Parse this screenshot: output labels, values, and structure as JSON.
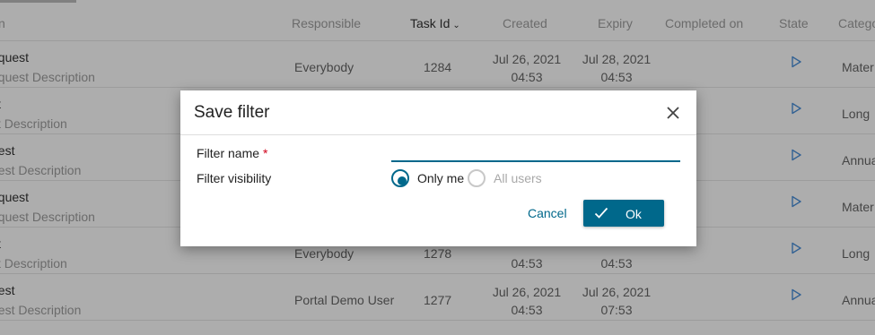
{
  "table": {
    "columns": {
      "name": "n",
      "responsible": "Responsible",
      "task_id": "Task Id",
      "created": "Created",
      "expiry": "Expiry",
      "completed_on": "Completed on",
      "state": "State",
      "category": "Catego"
    },
    "rows": [
      {
        "name": "equest",
        "desc": "equest Description",
        "responsible": "Everybody",
        "task_id": "1284",
        "created_date": "Jul 26, 2021",
        "created_time": "04:53",
        "expiry_date": "Jul 28, 2021",
        "expiry_time": "04:53",
        "category": "Mater"
      },
      {
        "name": "st",
        "desc": "st Description",
        "responsible": "",
        "task_id": "",
        "created_date": "",
        "created_time": "",
        "expiry_date": "",
        "expiry_time": "",
        "category": "Long"
      },
      {
        "name": "uest",
        "desc": "uest Description",
        "responsible": "",
        "task_id": "",
        "created_date": "",
        "created_time": "",
        "expiry_date": "",
        "expiry_time": "",
        "category": "Annua"
      },
      {
        "name": "equest",
        "desc": "equest Description",
        "responsible": "",
        "task_id": "",
        "created_date": "",
        "created_time": "",
        "expiry_date": "",
        "expiry_time": "",
        "category": "Mater"
      },
      {
        "name": "st",
        "desc": "st Description",
        "responsible": "Everybody",
        "task_id": "1278",
        "created_date": "",
        "created_time": "04:53",
        "expiry_date": "",
        "expiry_time": "04:53",
        "category": "Long"
      },
      {
        "name": "uest",
        "desc": "uest Description",
        "responsible": "Portal Demo User",
        "task_id": "1277",
        "created_date": "Jul 26, 2021",
        "created_time": "04:53",
        "expiry_date": "Jul 26, 2021",
        "expiry_time": "07:53",
        "category": "Annua"
      }
    ]
  },
  "dialog": {
    "title": "Save filter",
    "filter_name_label": "Filter name",
    "required_marker": "*",
    "filter_name_value": "",
    "filter_visibility_label": "Filter visibility",
    "visibility_options": [
      {
        "label": "Only me",
        "selected": true
      },
      {
        "label": "All users",
        "selected": false
      }
    ],
    "cancel_label": "Cancel",
    "ok_label": "Ok"
  },
  "colors": {
    "accent": "#00688b",
    "required": "#d0021b",
    "play_icon": "#4a90d9"
  },
  "icons": {
    "close": "close-icon",
    "check": "check-icon",
    "sort": "chevron-down-icon",
    "state": "play-icon"
  }
}
